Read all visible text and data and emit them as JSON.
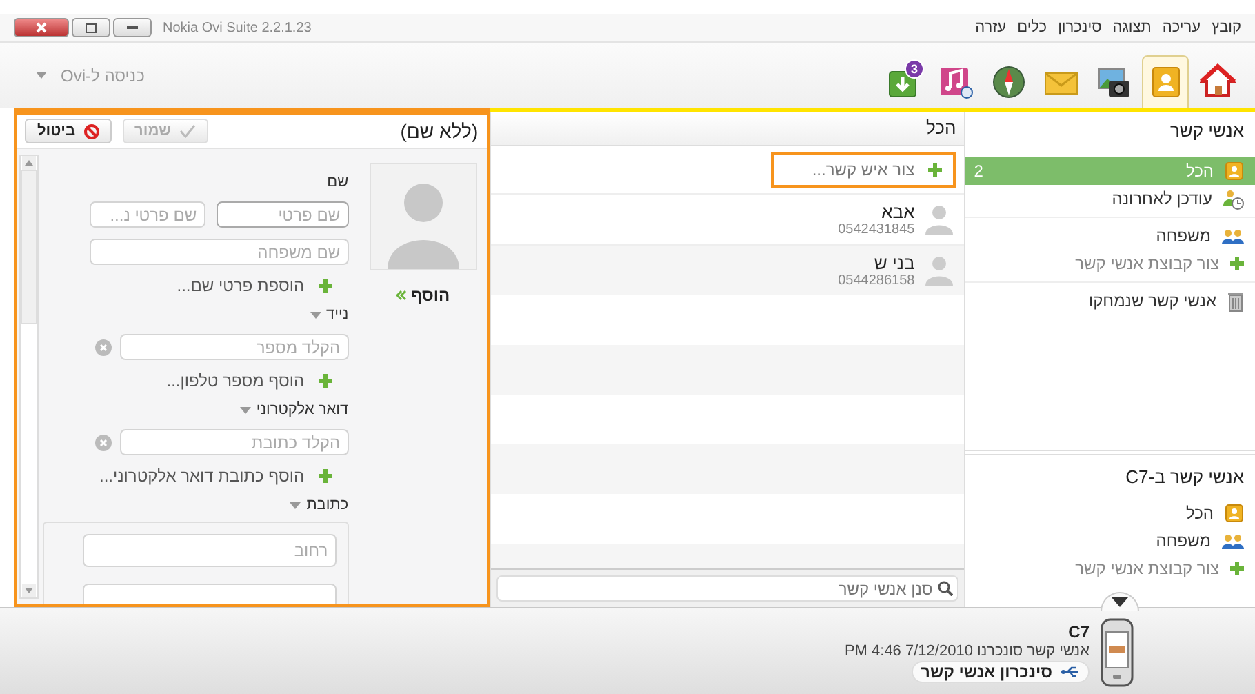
{
  "window": {
    "title": "Nokia Ovi Suite 2.2.1.23"
  },
  "menu": [
    "קובץ",
    "עריכה",
    "תצוגה",
    "סינכרון",
    "כלים",
    "עזרה"
  ],
  "toolbar": {
    "tools": [
      {
        "selected": false
      },
      {
        "selected": true
      },
      {
        "selected": false
      },
      {
        "selected": false
      },
      {
        "selected": false
      },
      {
        "selected": false
      },
      {
        "selected": false,
        "badge": "3"
      }
    ],
    "login": "כניסה ל-Ovi"
  },
  "editor": {
    "title": "(ללא שם)",
    "highlighted": true,
    "buttons": [
      {
        "label": "שמור",
        "kind": "save",
        "disabled": true
      },
      {
        "label": "ביטול",
        "kind": "cancel",
        "disabled": false
      }
    ],
    "photo_link": "הוסף",
    "sections": [
      {
        "kind": "name",
        "label": "שם",
        "dropdown": false,
        "fields": [
          {
            "placeholder": "שם פרטי"
          },
          {
            "placeholder": "שם פרטי נ..."
          },
          {
            "placeholder": "שם משפחה"
          }
        ],
        "add_link": "הוספת פרטי שם..."
      },
      {
        "kind": "list",
        "label": "נייד",
        "dropdown": true,
        "fields": [
          {
            "placeholder": "הקלד מספר",
            "clearable": true
          }
        ],
        "add_link": "הוסף מספר טלפון..."
      },
      {
        "kind": "list",
        "label": "דואר אלקטרוני",
        "dropdown": true,
        "fields": [
          {
            "placeholder": "הקלד כתובת",
            "clearable": true
          }
        ],
        "add_link": "הוסף כתובת דואר אלקטרוני..."
      },
      {
        "kind": "box",
        "label": "כתובת",
        "dropdown": true,
        "fields": [
          {
            "placeholder": "רחוב"
          }
        ]
      }
    ]
  },
  "contacts": {
    "title": "הכל",
    "create": {
      "label": "צור איש קשר...",
      "highlighted": true
    },
    "rows": [
      {
        "name": "אבא",
        "phone": "0542431845"
      },
      {
        "name": "בני ש",
        "phone": "0544286158"
      }
    ],
    "filter": {
      "placeholder": "סנן אנשי קשר"
    }
  },
  "sidebar": {
    "title": "אנשי קשר",
    "groups": [
      [
        {
          "kind": "all",
          "label": "הכל",
          "count": "2",
          "selected": true
        },
        {
          "kind": "recent",
          "label": "עודכן לאחרונה",
          "selected": false
        }
      ],
      [
        {
          "kind": "group",
          "label": "משפחה",
          "selected": false
        },
        {
          "kind": "add",
          "label": "צור קבוצת אנשי קשר",
          "selected": false
        }
      ],
      [
        {
          "kind": "deleted",
          "label": "אנשי קשר שנמחקו",
          "selected": false
        }
      ]
    ],
    "device_title": "אנשי קשר ב-C7",
    "device_items": [
      {
        "kind": "all",
        "label": "הכל",
        "selected": false
      },
      {
        "kind": "group",
        "label": "משפחה",
        "selected": false
      },
      {
        "kind": "add",
        "label": "צור קבוצת אנשי קשר",
        "selected": false
      }
    ]
  },
  "status_bar": {
    "device": "C7",
    "synced": "אנשי קשר סונכרנו 7/12/2010 4:46 PM",
    "sync_button": "סינכרון אנשי קשר"
  }
}
